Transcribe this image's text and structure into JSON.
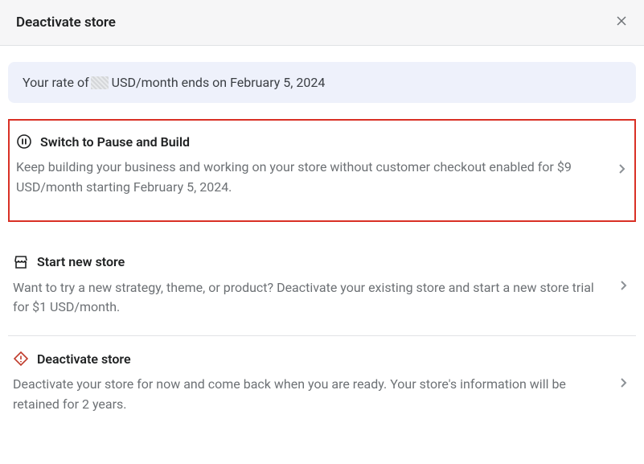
{
  "header": {
    "title": "Deactivate store"
  },
  "banner": {
    "prefix": "Your rate of",
    "suffix": "USD/month ends on February 5, 2024"
  },
  "options": {
    "pause": {
      "title": "Switch to Pause and Build",
      "desc": "Keep building your business and working on your store without customer checkout enabled for $9 USD/month starting February 5, 2024."
    },
    "newstore": {
      "title": "Start new store",
      "desc": "Want to try a new strategy, theme, or product? Deactivate your existing store and start a new store trial for $1 USD/month."
    },
    "deactivate": {
      "title": "Deactivate store",
      "desc": "Deactivate your store for now and come back when you are ready. Your store's information will be retained for 2 years."
    }
  }
}
